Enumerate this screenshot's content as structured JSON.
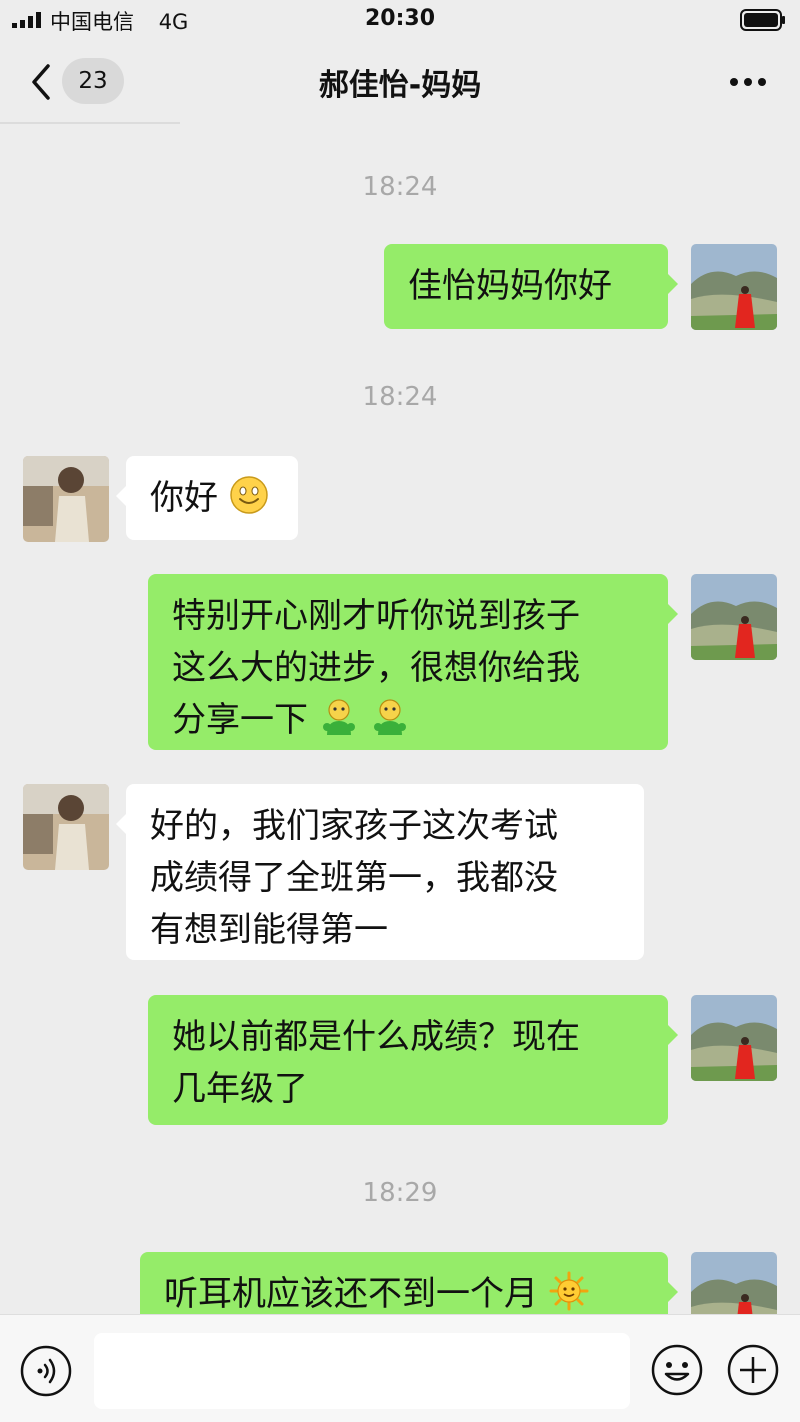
{
  "status_bar": {
    "carrier": "中国电信",
    "network": "4G",
    "time": "20:30"
  },
  "nav": {
    "back_badge": "23",
    "title": "郝佳怡-妈妈"
  },
  "chat": {
    "timestamps": [
      "18:24",
      "18:24",
      "18:29"
    ],
    "messages": [
      {
        "from": "me",
        "text": "佳怡妈妈你好"
      },
      {
        "from": "other",
        "text": "你好",
        "emoji": "smile-emoji"
      },
      {
        "from": "me",
        "lines": [
          "特别开心刚才听你说到孩子",
          "这么大的进步，很想你给我",
          "分享一下"
        ],
        "emoji": "green-person-emoji x2"
      },
      {
        "from": "other",
        "lines": [
          "好的，我们家孩子这次考试",
          "成绩得了全班第一，我都没",
          "有想到能得第一"
        ]
      },
      {
        "from": "me",
        "lines": [
          "她以前都是什么成绩？现在",
          "几年级了"
        ]
      },
      {
        "from": "me",
        "text": "听耳机应该还不到一个月",
        "emoji": "sun-emoji"
      }
    ]
  },
  "input_bar": {
    "placeholder": ""
  },
  "colors": {
    "background": "#ededed",
    "my_bubble": "#95ec69",
    "other_bubble": "#ffffff",
    "timestamp": "#a8a8a8"
  },
  "icons": [
    "signal-icon",
    "battery-icon",
    "back-chevron-icon",
    "more-icon",
    "voice-icon",
    "emoji-icon",
    "plus-icon"
  ]
}
